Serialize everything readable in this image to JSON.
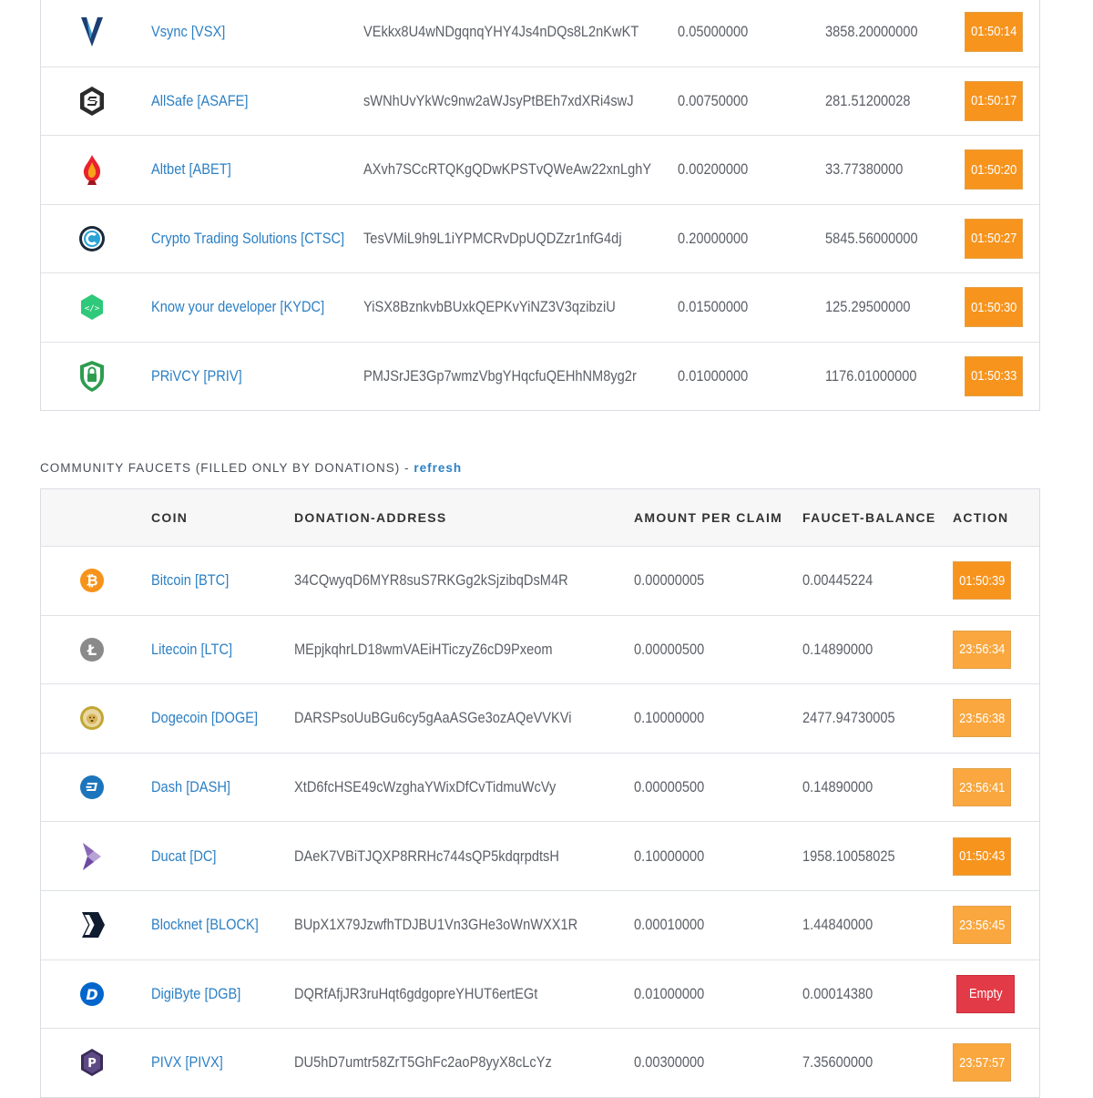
{
  "top_faucets": [
    {
      "coin": "Vsync [VSX]",
      "address": "VEkkx8U4wNDgqnqYHY4Js4nDQs8L2nKwKT",
      "amount": "0.05000000",
      "balance": "3858.20000000",
      "action": "01:50:14",
      "icon": "vsync-icon"
    },
    {
      "coin": "AllSafe [ASAFE]",
      "address": "sWNhUvYkWc9nw2aWJsyPtBEh7xdXRi4swJ",
      "amount": "0.00750000",
      "balance": "281.51200028",
      "action": "01:50:17",
      "icon": "allsafe-icon"
    },
    {
      "coin": "Altbet [ABET]",
      "address": "AXvh7SCcRTQKgQDwKPSTvQWeAw22xnLghY",
      "amount": "0.00200000",
      "balance": "33.77380000",
      "action": "01:50:20",
      "icon": "altbet-icon"
    },
    {
      "coin": "Crypto Trading Solutions [CTSC]",
      "address": "TesVMiL9h9L1iYPMCRvDpUQDZzr1nfG4dj",
      "amount": "0.20000000",
      "balance": "5845.56000000",
      "action": "01:50:27",
      "icon": "ctsc-icon"
    },
    {
      "coin": "Know your developer [KYDC]",
      "address": "YiSX8BznkvbBUxkQEPKvYiNZ3V3qzibziU",
      "amount": "0.01500000",
      "balance": "125.29500000",
      "action": "01:50:30",
      "icon": "kydc-icon"
    },
    {
      "coin": "PRiVCY [PRIV]",
      "address": "PMJSrJE3Gp7wmzVbgYHqcfuQEHhNM8yg2r",
      "amount": "0.01000000",
      "balance": "1176.01000000",
      "action": "01:50:33",
      "icon": "privcy-icon"
    }
  ],
  "community": {
    "title": "COMMUNITY FAUCETS (FILLED ONLY BY DONATIONS) -",
    "refresh_label": "refresh",
    "headers": {
      "coin": "COIN",
      "address": "DONATION-ADDRESS",
      "amount": "AMOUNT PER CLAIM",
      "balance": "FAUCET-BALANCE",
      "action": "ACTION"
    },
    "rows": [
      {
        "coin": "Bitcoin [BTC]",
        "address": "34CQwyqD6MYR8suS7RKGg2kSjzibqDsM4R",
        "amount": "0.00000005",
        "balance": "0.00445224",
        "action": "01:50:39",
        "action_type": "timer",
        "icon": "bitcoin-icon"
      },
      {
        "coin": "Litecoin [LTC]",
        "address": "MEpjkqhrLD18wmVAEiHTiczyZ6cD9Pxeom",
        "amount": "0.00000500",
        "balance": "0.14890000",
        "action": "23:56:34",
        "action_type": "timer-light",
        "icon": "litecoin-icon"
      },
      {
        "coin": "Dogecoin [DOGE]",
        "address": "DARSPsoUuBGu6cy5gAaASGe3ozAQeVVKVi",
        "amount": "0.10000000",
        "balance": "2477.94730005",
        "action": "23:56:38",
        "action_type": "timer-light",
        "icon": "dogecoin-icon"
      },
      {
        "coin": "Dash [DASH]",
        "address": "XtD6fcHSE49cWzghaYWixDfCvTidmuWcVy",
        "amount": "0.00000500",
        "balance": "0.14890000",
        "action": "23:56:41",
        "action_type": "timer-light",
        "icon": "dash-icon"
      },
      {
        "coin": "Ducat [DC]",
        "address": "DAeK7VBiTJQXP8RRHc744sQP5kdqrpdtsH",
        "amount": "0.10000000",
        "balance": "1958.10058025",
        "action": "01:50:43",
        "action_type": "timer",
        "icon": "ducat-icon"
      },
      {
        "coin": "Blocknet [BLOCK]",
        "address": "BUpX1X79JzwfhTDJBU1Vn3GHe3oWnWXX1R",
        "amount": "0.00010000",
        "balance": "1.44840000",
        "action": "23:56:45",
        "action_type": "timer-light",
        "icon": "blocknet-icon"
      },
      {
        "coin": "DigiByte [DGB]",
        "address": "DQRfAfjJR3ruHqt6gdgopreYHUT6ertEGt",
        "amount": "0.01000000",
        "balance": "0.00014380",
        "action": "Empty",
        "action_type": "empty",
        "icon": "digibyte-icon"
      },
      {
        "coin": "PIVX [PIVX]",
        "address": "DU5hD7umtr58ZrT5GhFc2aoP8yyX8cLcYz",
        "amount": "0.00300000",
        "balance": "7.35600000",
        "action": "23:57:57",
        "action_type": "timer-light",
        "icon": "pivx-icon"
      }
    ]
  },
  "colors": {
    "link": "#2b7fc4",
    "timer": "#f7941d",
    "timer_light": "#f9a73e",
    "empty": "#e33a47"
  }
}
